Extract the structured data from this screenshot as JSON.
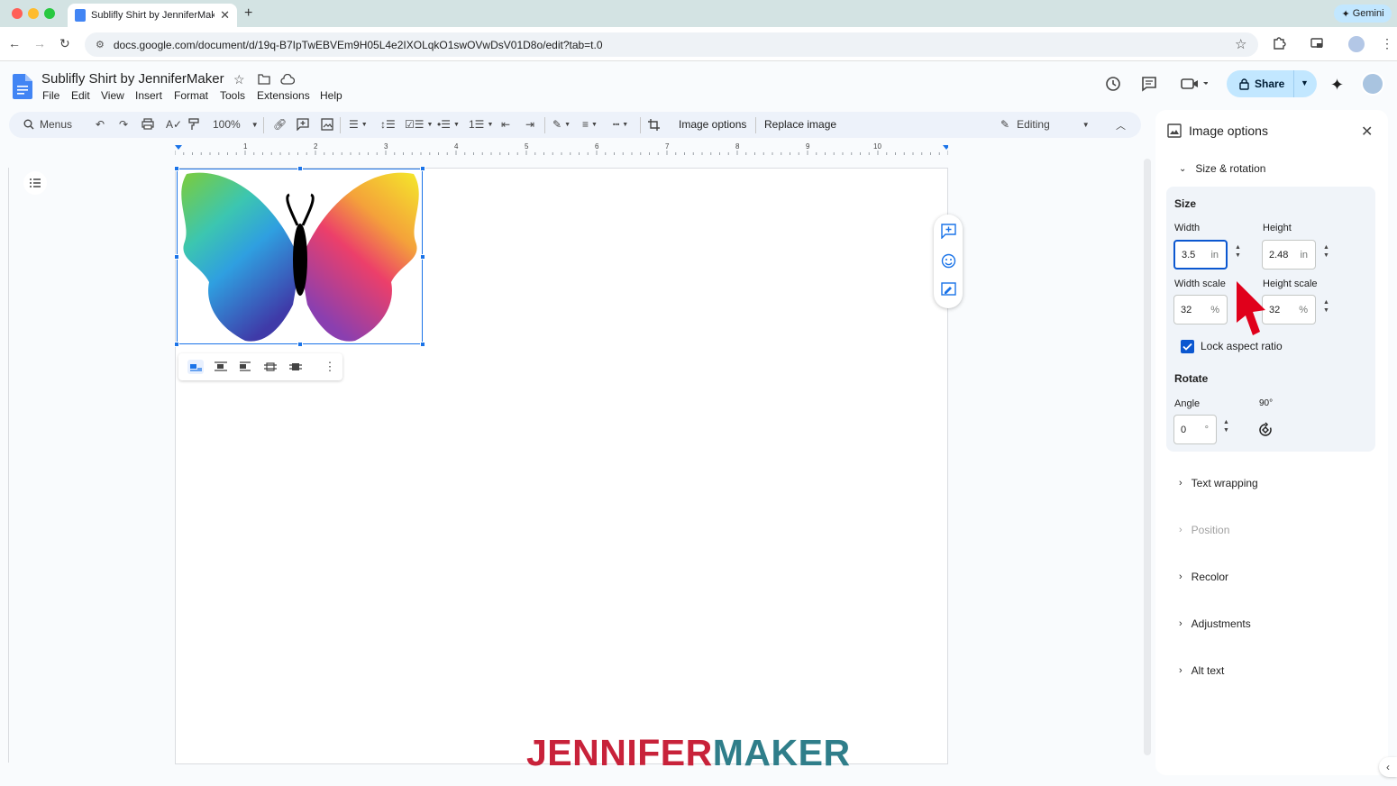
{
  "browser": {
    "tab_title": "Sublifly Shirt by JenniferMak",
    "url": "docs.google.com/document/d/19q-B7IpTwEBVEm9H05L4e2IXOLqkO1swOVwDsV01D8o/edit?tab=t.0",
    "gemini_label": "Gemini"
  },
  "doc": {
    "title": "Sublifly Shirt by JenniferMaker",
    "menus": [
      "File",
      "Edit",
      "View",
      "Insert",
      "Format",
      "Tools",
      "Extensions",
      "Help"
    ],
    "share_label": "Share"
  },
  "toolbar": {
    "menus_label": "Menus",
    "zoom": "100%",
    "image_options": "Image options",
    "replace_image": "Replace image",
    "mode": "Editing"
  },
  "ruler": {
    "numbers": [
      "1",
      "2",
      "3",
      "4",
      "5",
      "6",
      "7",
      "8",
      "9",
      "10"
    ]
  },
  "brand": {
    "part1": "JENNIFER",
    "part2": "MAKER"
  },
  "panel": {
    "title": "Image options",
    "size_rotation": "Size & rotation",
    "size_heading": "Size",
    "width_label": "Width",
    "width_value": "3.5",
    "height_label": "Height",
    "height_value": "2.48",
    "unit_in": "in",
    "width_scale_label": "Width scale",
    "width_scale_value": "32",
    "height_scale_label": "Height scale",
    "height_scale_value": "32",
    "unit_pct": "%",
    "lock_label": "Lock aspect ratio",
    "rotate_heading": "Rotate",
    "angle_label": "Angle",
    "angle_value": "0",
    "unit_deg": "°",
    "rotate90_label": "90°",
    "text_wrapping": "Text wrapping",
    "position": "Position",
    "recolor": "Recolor",
    "adjustments": "Adjustments",
    "alt_text": "Alt text"
  },
  "colors": {
    "accent": "#0b57d0",
    "share_bg": "#c2e7ff",
    "selection": "#1a73e8",
    "cursor_arrow": "#e0001b",
    "brand_red": "#c8223a",
    "brand_teal": "#2f7e8a"
  }
}
